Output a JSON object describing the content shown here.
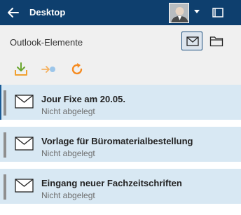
{
  "header": {
    "title": "Desktop",
    "back_icon": "arrow-left-icon",
    "avatar_icon": "user-avatar",
    "menu_icon": "caret-down-icon",
    "window_icon": "window-icon"
  },
  "panel": {
    "title": "Outlook-Elemente",
    "view_buttons": [
      {
        "icon": "envelope-icon",
        "active": true
      },
      {
        "icon": "folder-icon",
        "active": false
      }
    ]
  },
  "toolbar": {
    "tools": [
      {
        "icon": "download-tray-icon",
        "color": "#7cb83a"
      },
      {
        "icon": "arrow-right-dot-icon",
        "color": "#f5a623"
      },
      {
        "icon": "refresh-icon",
        "color": "#f58a1f"
      }
    ]
  },
  "mails": [
    {
      "subject": "Jour Fixe am 20.05.",
      "status": "Nicht abgelegt"
    },
    {
      "subject": "Vorlage für Büromaterialbestellung",
      "status": "Nicht abgelegt"
    },
    {
      "subject": "Eingang neuer Fachzeitschriften",
      "status": "Nicht abgelegt"
    }
  ],
  "colors": {
    "header_bg": "#0e3f6e",
    "item_bg": "#d8e8f3",
    "accent": "#1c5c96"
  }
}
